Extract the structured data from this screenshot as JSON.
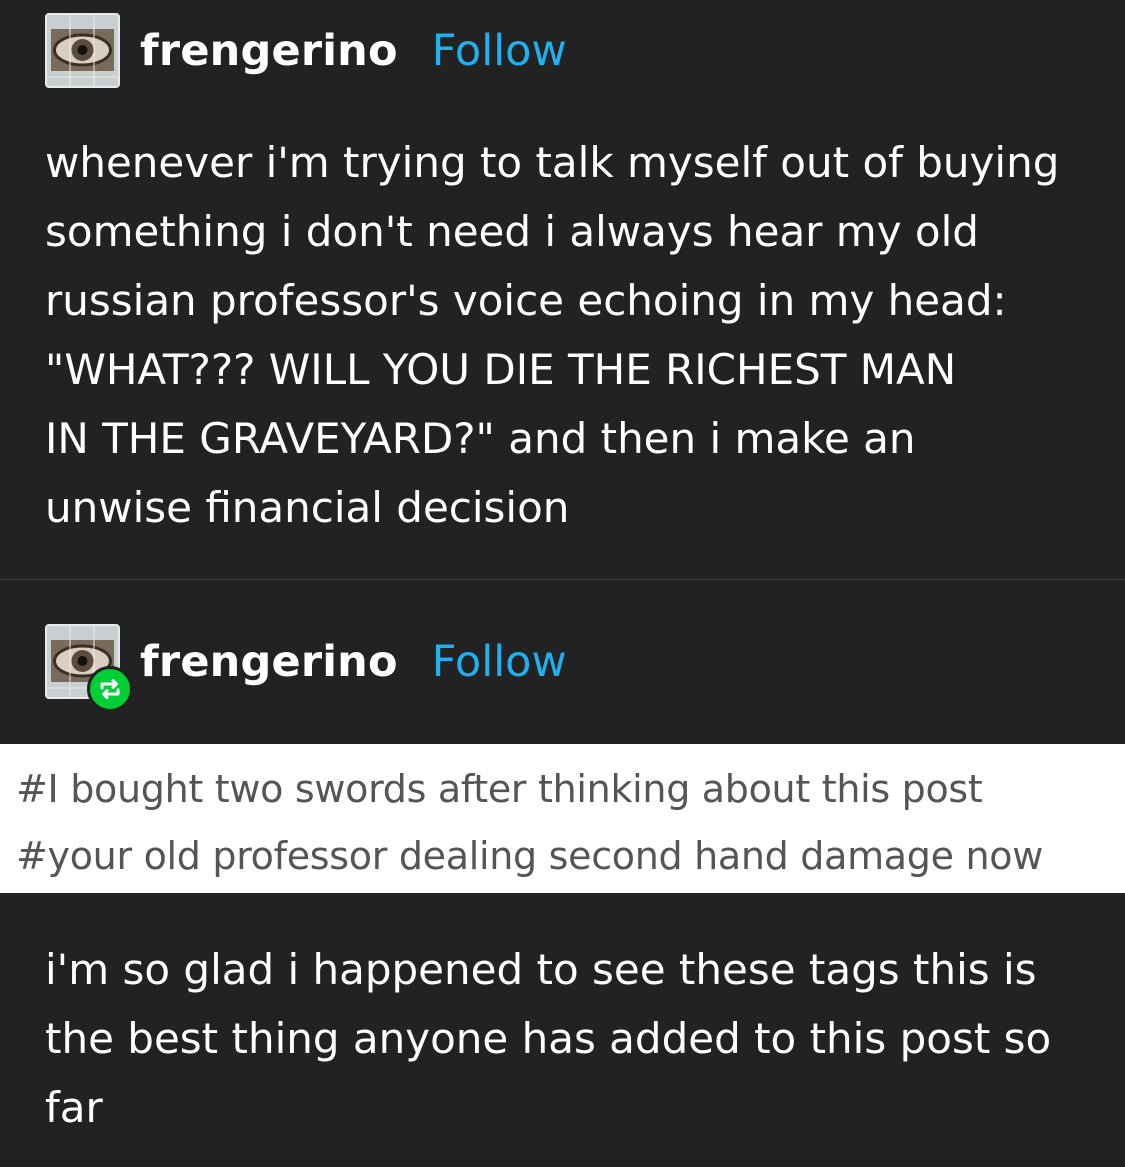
{
  "posts": [
    {
      "username": "frengerino",
      "follow_label": "Follow",
      "body_lines": [
        "whenever i'm trying to talk myself out of buying",
        "something i don't need i always hear my old",
        "russian professor's voice echoing in my head:",
        "\"WHAT??? WILL YOU DIE THE RICHEST MAN",
        "IN THE GRAVEYARD?\" and then i make an",
        "unwise financial decision"
      ]
    },
    {
      "username": "frengerino",
      "follow_label": "Follow",
      "reblog_icon": "reblog-icon"
    }
  ],
  "tags": [
    "#I bought two swords after thinking about this post",
    "#your old professor dealing second hand damage now"
  ],
  "reply_lines": [
    "i'm so glad i happened to see these tags this is",
    "the best thing anyone has added to this post so",
    "far"
  ],
  "colors": {
    "background": "#222222",
    "follow": "#1fb0ef",
    "reblog_badge": "#00cf35",
    "tag_text": "#555555"
  }
}
